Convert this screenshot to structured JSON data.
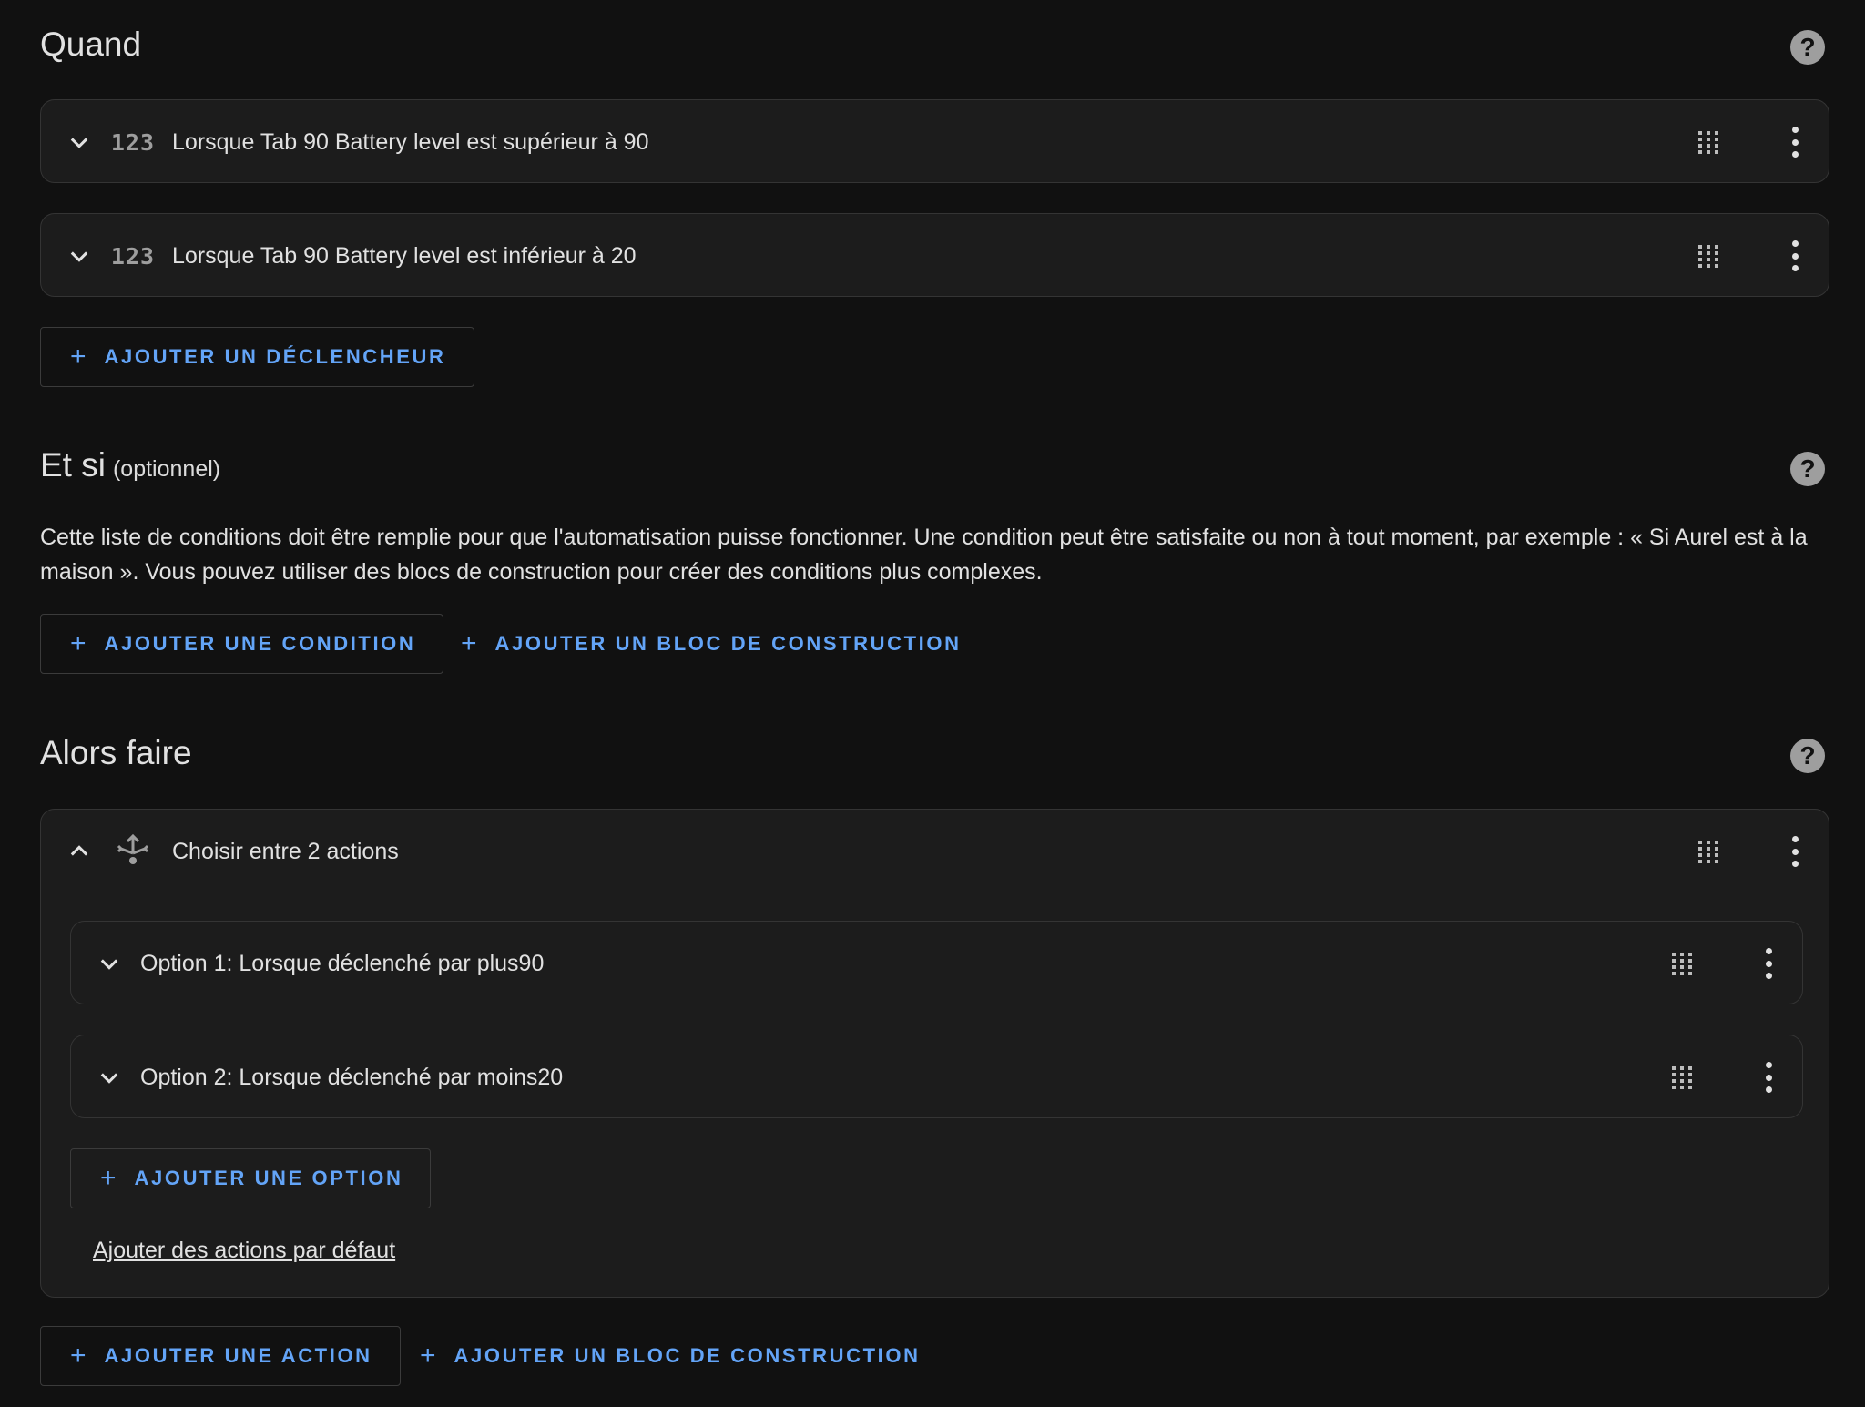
{
  "when": {
    "title": "Quand",
    "triggers": [
      {
        "icon": "123",
        "label": "Lorsque Tab 90 Battery level est supérieur à 90"
      },
      {
        "icon": "123",
        "label": "Lorsque Tab 90 Battery level est inférieur à 20"
      }
    ],
    "add_trigger_label": "AJOUTER UN DÉCLENCHEUR"
  },
  "and_if": {
    "title": "Et si",
    "optional_label": "(optionnel)",
    "description": "Cette liste de conditions doit être remplie pour que l'automatisation puisse fonctionner. Une condition peut être satisfaite ou non à tout moment, par exemple : « Si Aurel est à la maison ». Vous pouvez utiliser des blocs de construction pour créer des conditions plus complexes.",
    "add_condition_label": "AJOUTER UNE CONDITION",
    "add_building_block_label": "AJOUTER UN BLOC DE CONSTRUCTION"
  },
  "then_do": {
    "title": "Alors faire",
    "choose": {
      "label": "Choisir entre 2 actions",
      "options": [
        {
          "label": "Option 1: Lorsque déclenché par plus90"
        },
        {
          "label": "Option 2: Lorsque déclenché par moins20"
        }
      ],
      "add_option_label": "AJOUTER UNE OPTION",
      "add_default_label": "Ajouter des actions par défaut"
    },
    "add_action_label": "AJOUTER UNE ACTION",
    "add_building_block_label": "AJOUTER UN BLOC DE CONSTRUCTION"
  },
  "colors": {
    "background": "#111111",
    "card": "#1c1c1c",
    "accent": "#63a4f7",
    "border": "#343434"
  },
  "icons": [
    "help-icon",
    "chevron-down-icon",
    "chevron-up-icon",
    "numeric-icon",
    "choose-branch-icon",
    "drag-handle-icon",
    "more-vertical-icon",
    "plus-icon"
  ]
}
